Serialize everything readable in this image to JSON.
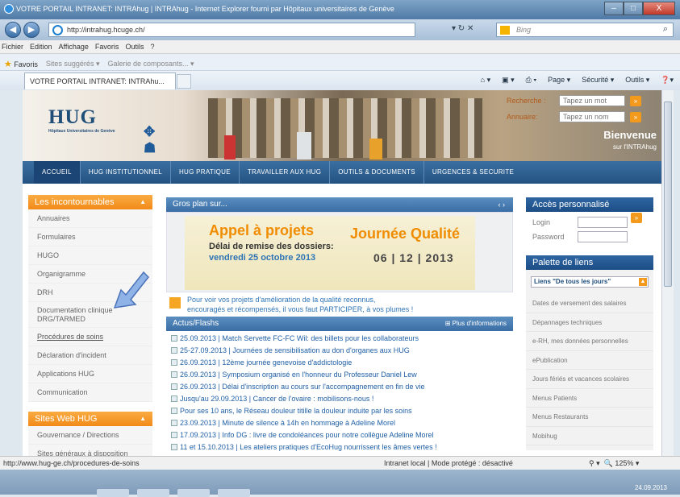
{
  "window": {
    "title": "VOTRE PORTAIL INTRANET: INTRAhug | INTRAhug - Internet Explorer fourni par Hôpitaux universitaires de Genève",
    "controls": [
      "–",
      "□",
      "X"
    ]
  },
  "address": {
    "url": "http://intrahug.hcuge.ch/",
    "search_placeholder": "Bing"
  },
  "menu": [
    "Fichier",
    "Edition",
    "Affichage",
    "Favoris",
    "Outils",
    "?"
  ],
  "favorites": {
    "label": "Favoris",
    "items": [
      "Sites suggérés ▾",
      "Galerie de composants... ▾"
    ]
  },
  "tab": {
    "label": "VOTRE PORTAIL INTRANET: INTRAhu..."
  },
  "commandbar": [
    "Page ▾",
    "Sécurité ▾",
    "Outils ▾"
  ],
  "header": {
    "logo": "HUG",
    "logo_sub": "Hôpitaux Universitaires de Genève",
    "recherche_label": "Recherche :",
    "recherche_placeholder": "Tapez un mot",
    "annuaire_label": "Annuaire:",
    "annuaire_placeholder": "Tapez un nom",
    "welcome": "Bienvenue",
    "welcome_sub": "sur l'INTRAhug"
  },
  "nav": [
    "ACCUEIL",
    "HUG INSTITUTIONNEL",
    "HUG PRATIQUE",
    "TRAVAILLER AUX HUG",
    "OUTILS & DOCUMENTS",
    "URGENCES & SECURITE"
  ],
  "left": {
    "incontournables_title": "Les incontournables",
    "items": [
      "Annuaires",
      "Formulaires",
      "HUGO",
      "Organigramme",
      "DRH",
      "Documentation clinique DRG/TARMED",
      "Procédures de soins",
      "Déclaration d'incident",
      "Applications HUG",
      "Communication"
    ],
    "sites_title": "Sites Web HUG",
    "sites": [
      "Gouvernance / Directions",
      "Sites généraux à disposition"
    ]
  },
  "center": {
    "grosplan_title": "Gros plan sur...",
    "grosplan_ctrl": "‹  ›",
    "appel_title": "Appel à projets",
    "appel_sub": "Délai de remise des dossiers:",
    "appel_date": "vendredi 25 octobre 2013",
    "journee_title": "Journée Qualité",
    "journee_date": "06 | 12 | 2013",
    "promo_line1": "Pour voir vos projets d'amélioration de la qualité reconnus,",
    "promo_line2": "encouragés et récompensés, il vous faut PARTICIPER, à vos plumes !",
    "actus_title": "Actus/Flashs",
    "actus_more": "⊞ Plus d'informations",
    "news": [
      "25.09.2013 | Match Servette FC-FC Wil: des billets pour les collaborateurs",
      "25-27.09.2013 | Journées de sensibilisation au don d'organes aux HUG",
      "26.09.2013 | 12ème journée genevoise d'addictologie",
      "26.09.2013 | Symposium organisé en l'honneur du Professeur Daniel Lew",
      "26.09.2013 | Délai d'inscription au cours sur l'accompagnement en fin de vie",
      "Jusqu'au 29.09.2013 | Cancer de l'ovaire : mobilisons-nous !",
      "Pour ses 10 ans, le Réseau douleur titille la douleur induite par les soins",
      "23.09.2013 | Minute de silence à 14h en hommage à Adeline Morel",
      "17.09.2013 | Info DG : livre de condoléances pour notre collègue Adeline Morel",
      "11 et 15.10.2013 | Les ateliers pratiques d'EcoHug nourrissent les âmes vertes !"
    ]
  },
  "right": {
    "acces_title": "Accès personnalisé",
    "login_label": "Login",
    "password_label": "Password",
    "palette_title": "Palette de liens",
    "select_value": "Liens \"De tous les jours\"",
    "links": [
      "Dates de versement des salaires",
      "Dépannages techniques",
      "e-RH, mes données personnelles",
      "ePublication",
      "Jours fériés et vacances scolaires",
      "Menus Patients",
      "Menus Restaurants",
      "Mobihug"
    ]
  },
  "status": {
    "url": "http://www.hug-ge.ch/procedures-de-soins",
    "zone": "Intranet local | Mode protégé : désactivé",
    "zoom": "125%"
  },
  "taskbar": {
    "clock": "24.09.2013"
  },
  "colors": {
    "orange": "#f28a18",
    "blue": "#3a6ea5",
    "navy": "#235281"
  }
}
